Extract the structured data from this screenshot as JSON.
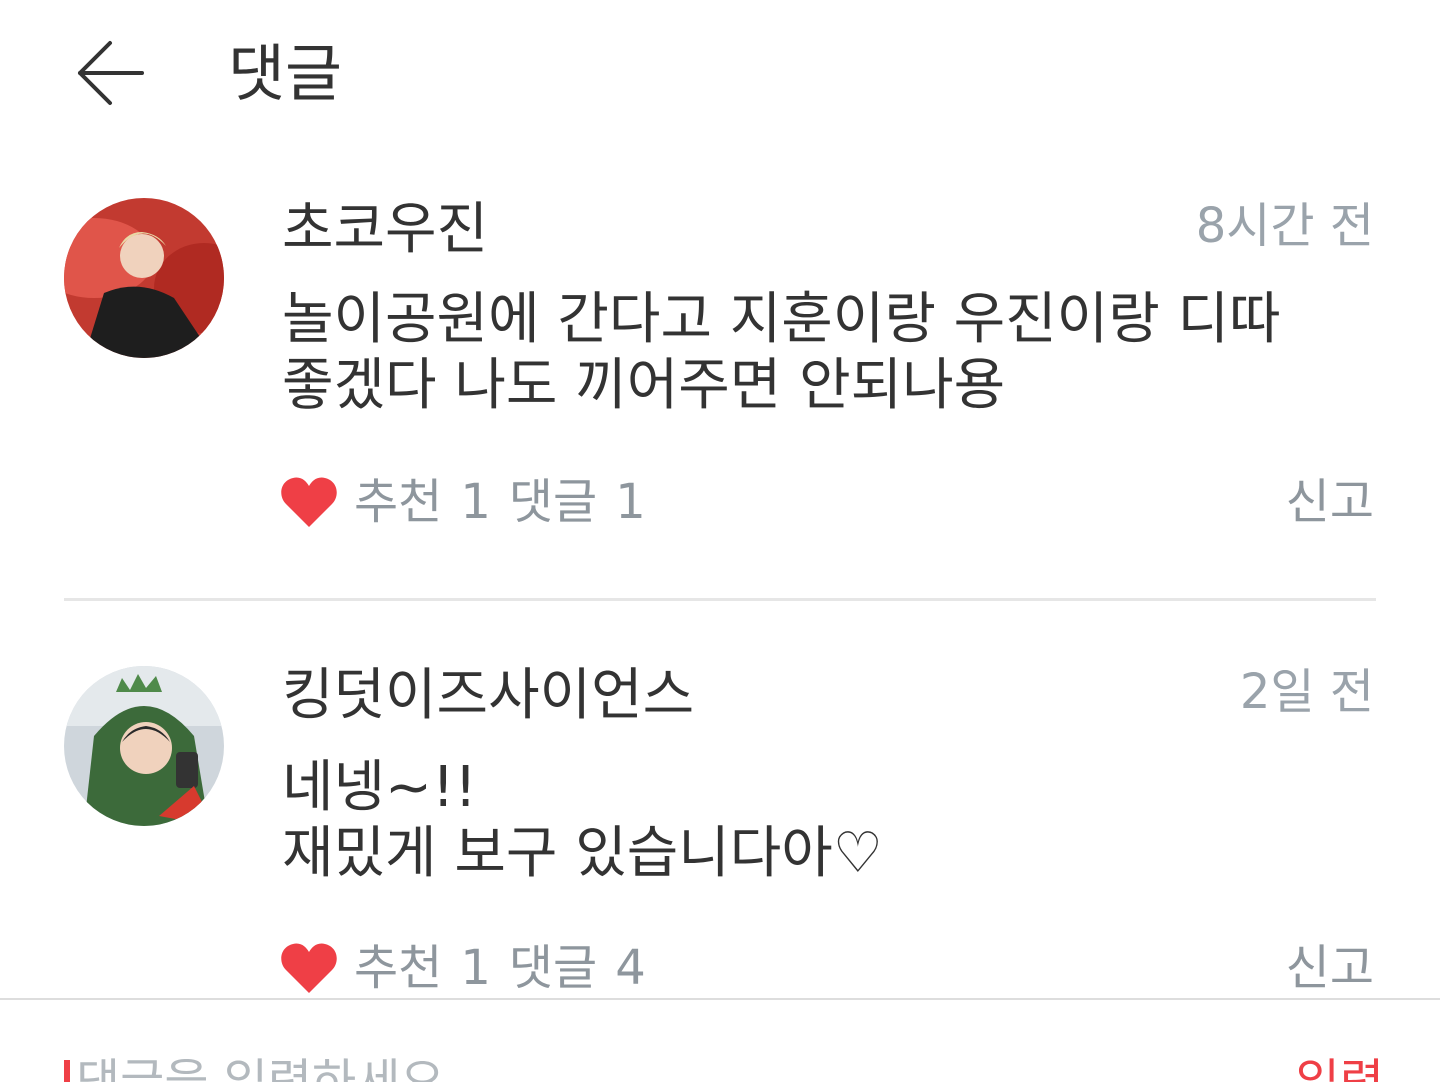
{
  "header": {
    "title": "댓글",
    "back_icon": "arrow-left-icon"
  },
  "comments": [
    {
      "author": "초코우진",
      "time": "8시간 전",
      "body_lines": [
        "놀이공원에 간다고 지훈이랑 우진이랑 디따",
        "좋겠다 나도 끼어주면 안되나용"
      ],
      "like_icon": "heart-icon",
      "likes_label": "추천",
      "likes_count": "1",
      "replies_label": "댓글",
      "replies_count": "1",
      "report_label": "신고"
    },
    {
      "author": "킹덧이즈사이언스",
      "time": "2일 전",
      "body_lines": [
        "네넹~!!",
        "재밌게 보구 있습니다아♡"
      ],
      "like_icon": "heart-icon",
      "likes_label": "추천",
      "likes_count": "1",
      "replies_label": "댓글",
      "replies_count": "4",
      "report_label": "신고"
    }
  ],
  "composer": {
    "placeholder": "댓글을 입력하세요",
    "submit_label": "입력"
  },
  "colors": {
    "accent": "#ef3f46",
    "muted_text": "#8e969d",
    "divider": "#e6e6e6"
  }
}
